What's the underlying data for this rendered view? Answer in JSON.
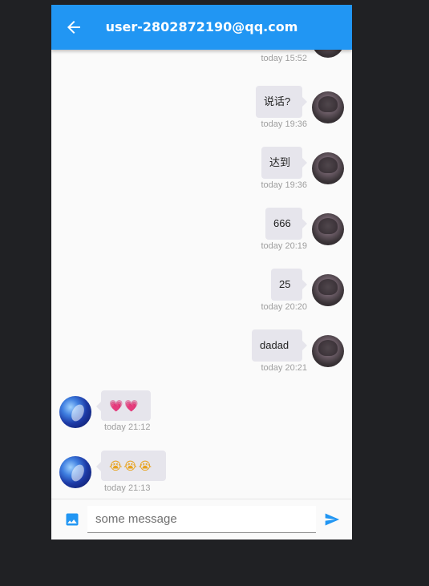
{
  "header": {
    "title": "user-2802872190@qq.com",
    "back_icon": "arrow-back-icon"
  },
  "messages": [
    {
      "side": "right",
      "text": "",
      "time": "today 15:52"
    },
    {
      "side": "right",
      "text": "说话?",
      "time": "today 19:36"
    },
    {
      "side": "right",
      "text": "达到",
      "time": "today 19:36"
    },
    {
      "side": "right",
      "text": "666",
      "time": "today 20:19"
    },
    {
      "side": "right",
      "text": "25",
      "time": "today 20:20"
    },
    {
      "side": "right",
      "text": "dadad",
      "time": "today 20:21"
    },
    {
      "side": "left",
      "text": "💗💗",
      "time": "today 21:12"
    },
    {
      "side": "left",
      "text": "😭😭😭",
      "time": "today 21:13"
    }
  ],
  "composer": {
    "placeholder": "some message",
    "image_icon": "image-icon",
    "send_icon": "send-icon"
  },
  "colors": {
    "primary": "#2196f3",
    "bubble": "#e6e5ec",
    "timestamp": "#9e9e9e"
  }
}
